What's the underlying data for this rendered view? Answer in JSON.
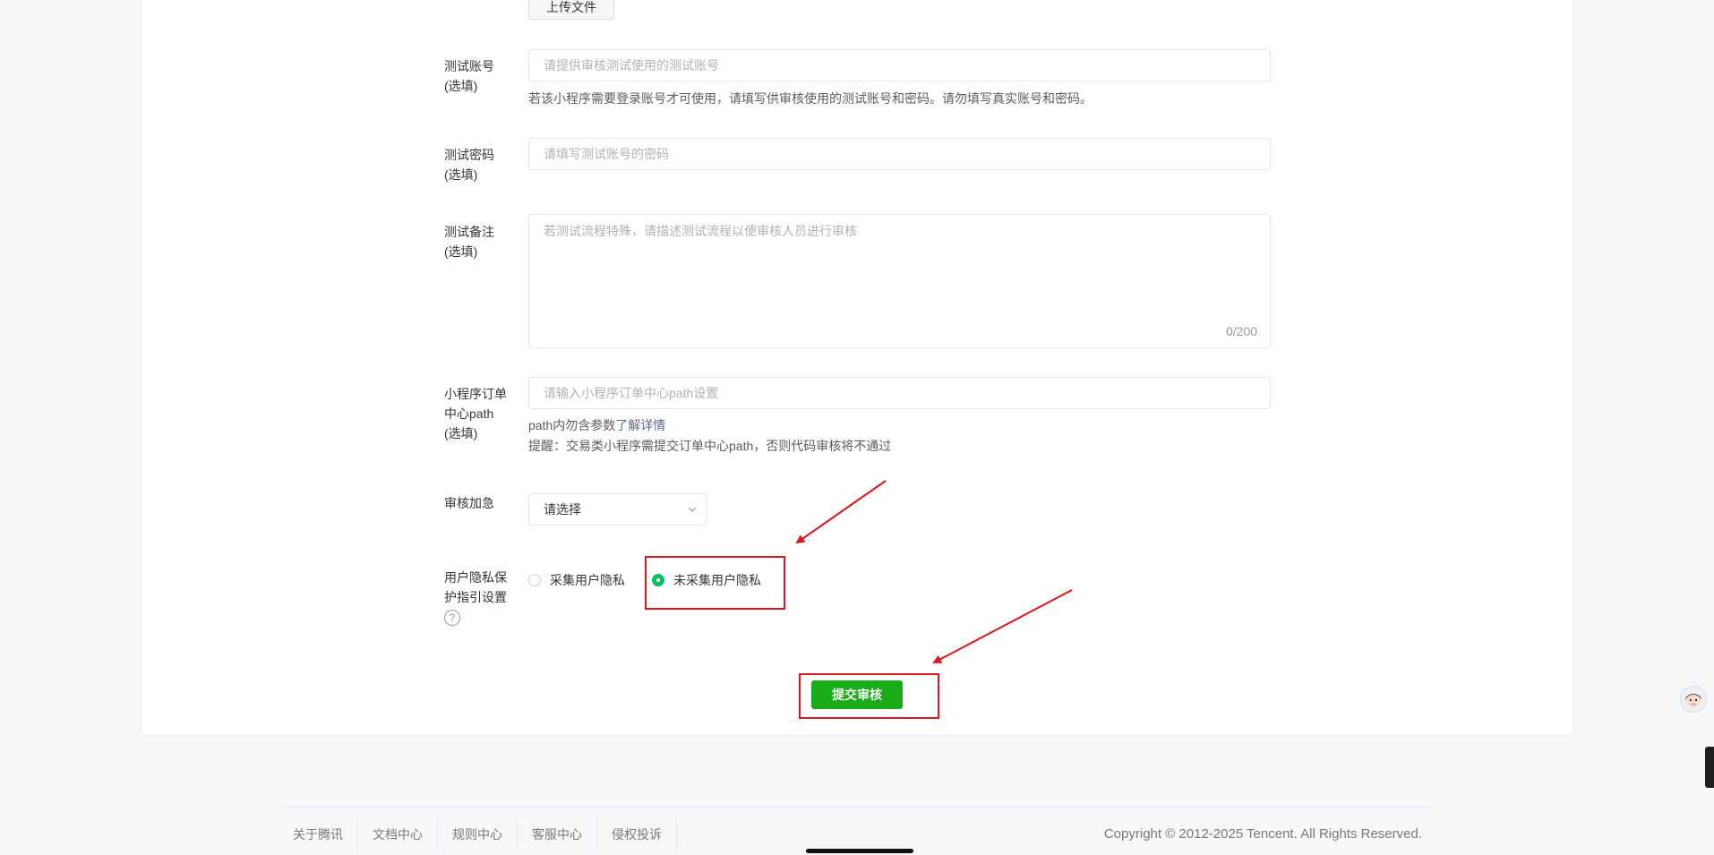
{
  "upload": {
    "label": "上传文件"
  },
  "test_account": {
    "label_line1": "测试账号",
    "label_line2": "(选填)",
    "placeholder": "请提供审核测试使用的测试账号",
    "hint": "若该小程序需要登录账号才可使用，请填写供审核使用的测试账号和密码。请勿填写真实账号和密码。"
  },
  "test_password": {
    "label_line1": "测试密码",
    "label_line2": "(选填)",
    "placeholder": "请填写测试账号的密码"
  },
  "test_notes": {
    "label_line1": "测试备注",
    "label_line2": "(选填)",
    "placeholder": "若测试流程特殊，请描述测试流程以便审核人员进行审核",
    "counter": "0/200"
  },
  "order_path": {
    "label_line1": "小程序订单",
    "label_line2": "中心path",
    "label_line3": "(选填)",
    "placeholder": "请输入小程序订单中心path设置",
    "hint_prefix": "path内勿含参数",
    "hint_link": "了解详情",
    "reminder": "提醒：交易类小程序需提交订单中心path，否则代码审核将不通过"
  },
  "expedite": {
    "label": "审核加急",
    "select_value": "请选择"
  },
  "privacy": {
    "label_line1": "用户隐私保",
    "label_line2": "护指引设置",
    "help_icon": "?",
    "options": [
      {
        "label": "采集用户隐私",
        "selected": false
      },
      {
        "label": "未采集用户隐私",
        "selected": true
      }
    ]
  },
  "submit": {
    "label": "提交审核"
  },
  "footer": {
    "links": [
      "关于腾讯",
      "文档中心",
      "规则中心",
      "客服中心",
      "侵权投诉"
    ],
    "copyright": "Copyright © 2012-2025 Tencent. All Rights Reserved."
  },
  "colors": {
    "primary_green": "#1aad19",
    "radio_green": "#07c160",
    "annotation_red": "#e0161b",
    "link_blue": "#576b95"
  }
}
